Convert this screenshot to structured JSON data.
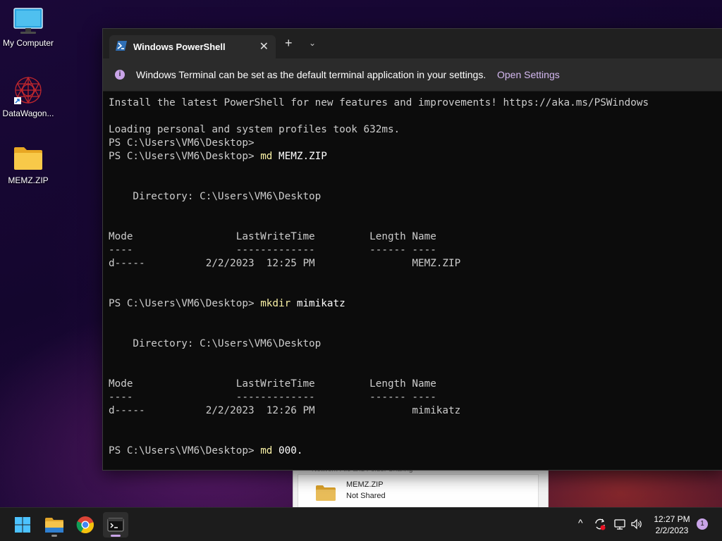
{
  "desktop": {
    "icons": [
      {
        "label": "My Computer",
        "icon": "monitor-icon"
      },
      {
        "label": "DataWagon...",
        "icon": "datawagon-shortcut-icon"
      },
      {
        "label": "MEMZ.ZIP",
        "icon": "folder-icon"
      }
    ]
  },
  "background_window": {
    "cut_text": "Network File and Folder Sharing",
    "item_name": "MEMZ.ZIP",
    "item_status": "Not Shared"
  },
  "terminal": {
    "tab_title": "Windows PowerShell",
    "tab_close": "✕",
    "new_tab": "+",
    "tab_dropdown": "⌄",
    "infobar": {
      "message": "Windows Terminal can be set as the default terminal application in your settings.",
      "link": "Open Settings"
    },
    "lines": [
      {
        "text": "Install the latest PowerShell for new features and improvements! https://aka.ms/PSWindows"
      },
      {
        "text": ""
      },
      {
        "text": "Loading personal and system profiles took 632ms."
      },
      {
        "text": "PS C:\\Users\\VM6\\Desktop>"
      },
      {
        "prompt": "PS C:\\Users\\VM6\\Desktop> ",
        "cmd": "md",
        "arg": " MEMZ.ZIP"
      },
      {
        "text": ""
      },
      {
        "text": ""
      },
      {
        "text": "    Directory: C:\\Users\\VM6\\Desktop"
      },
      {
        "text": ""
      },
      {
        "text": ""
      },
      {
        "text": "Mode                 LastWriteTime         Length Name"
      },
      {
        "text": "----                 -------------         ------ ----"
      },
      {
        "text": "d-----          2/2/2023  12:25 PM                MEMZ.ZIP"
      },
      {
        "text": ""
      },
      {
        "text": ""
      },
      {
        "prompt": "PS C:\\Users\\VM6\\Desktop> ",
        "cmd": "mkdir",
        "arg": " mimikatz"
      },
      {
        "text": ""
      },
      {
        "text": ""
      },
      {
        "text": "    Directory: C:\\Users\\VM6\\Desktop"
      },
      {
        "text": ""
      },
      {
        "text": ""
      },
      {
        "text": "Mode                 LastWriteTime         Length Name"
      },
      {
        "text": "----                 -------------         ------ ----"
      },
      {
        "text": "d-----          2/2/2023  12:26 PM                mimikatz"
      },
      {
        "text": ""
      },
      {
        "text": ""
      },
      {
        "prompt": "PS C:\\Users\\VM6\\Desktop> ",
        "cmd": "md",
        "arg": " 000."
      }
    ]
  },
  "taskbar": {
    "apps": [
      {
        "name": "start-button",
        "icon": "windows-logo-icon"
      },
      {
        "name": "file-explorer-button",
        "icon": "folder-icon"
      },
      {
        "name": "chrome-button",
        "icon": "chrome-icon"
      },
      {
        "name": "terminal-button",
        "icon": "terminal-icon"
      }
    ],
    "tray": {
      "chevron": "^",
      "time": "12:27 PM",
      "date": "2/2/2023",
      "notifications": "1"
    }
  },
  "colors": {
    "accent": "#c9a4e8",
    "terminal_bg": "#0c0c0c",
    "command": "#f9f1a5"
  }
}
